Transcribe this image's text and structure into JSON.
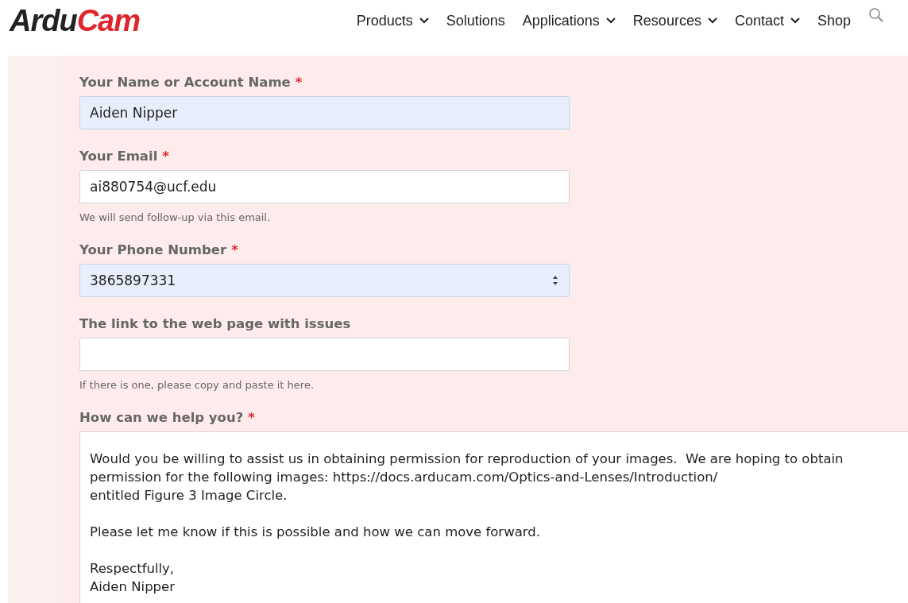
{
  "header": {
    "logo": [
      {
        "text": "Ardu",
        "kind": "dark"
      },
      {
        "text": "Cam",
        "kind": "accent"
      }
    ],
    "nav": [
      {
        "label": "Products",
        "has_dropdown": true
      },
      {
        "label": "Solutions",
        "has_dropdown": false
      },
      {
        "label": "Applications",
        "has_dropdown": true
      },
      {
        "label": "Resources",
        "has_dropdown": true
      },
      {
        "label": "Contact",
        "has_dropdown": true
      },
      {
        "label": "Shop",
        "has_dropdown": false
      }
    ]
  },
  "form": {
    "fields": [
      {
        "kind": "text",
        "label": "Your Name or Account Name",
        "required_mark": "*",
        "value": "Aiden Nipper",
        "autofilled": true
      },
      {
        "kind": "text",
        "label": "Your Email",
        "required_mark": "*",
        "value": "ai880754@ucf.edu",
        "autofilled": false,
        "help": "We will send follow-up via this email."
      },
      {
        "kind": "number",
        "label": "Your Phone Number",
        "required_mark": "*",
        "value": "3865897331",
        "autofilled": true
      },
      {
        "kind": "text",
        "label": "The link to the web page with issues",
        "autofilled": false,
        "help": "If there is one, please copy and paste it here."
      },
      {
        "kind": "textarea",
        "label": "How can we help you?",
        "required_mark": "*",
        "value": "Would you be willing to assist us in obtaining permission for reproduction of your images.  We are hoping to obtain permission for the following images: https://docs.arducam.com/Optics-and-Lenses/Introduction/\nentitled Figure 3 Image Circle.\n\nPlease let me know if this is possible and how we can move forward.\n\nRespectfully,\nAiden Nipper"
      }
    ]
  }
}
